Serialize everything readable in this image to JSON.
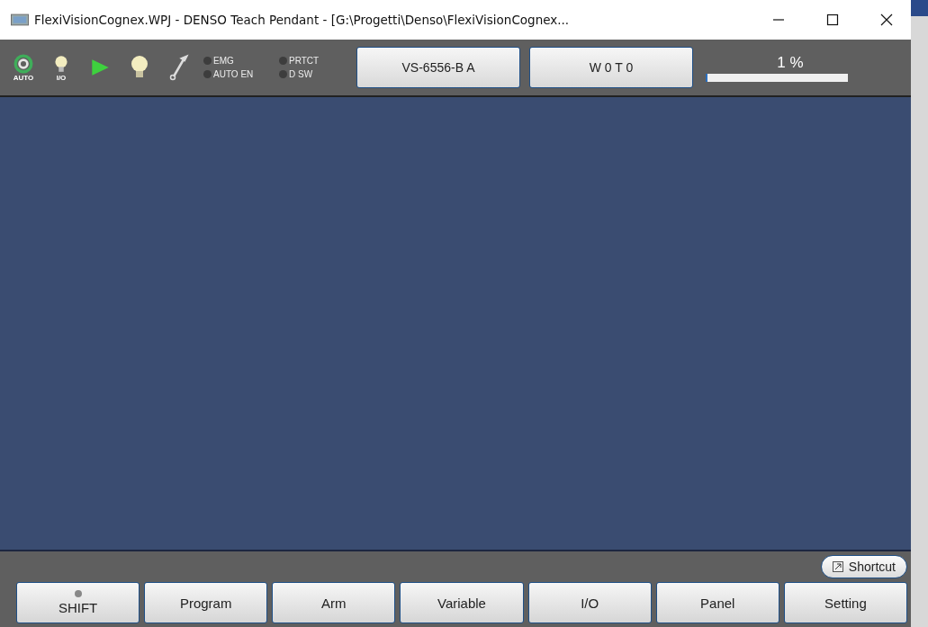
{
  "window": {
    "title": "FlexiVisionCognex.WPJ - DENSO Teach Pendant - [G:\\Progetti\\Denso\\FlexiVisionCognex..."
  },
  "toolbar": {
    "auto_label": "AUTO",
    "io_label": "I/O",
    "indicators": [
      {
        "label": "EMG",
        "on": false
      },
      {
        "label": "PRTCT",
        "on": false
      },
      {
        "label": "AUTO EN",
        "on": false
      },
      {
        "label": "D SW",
        "on": false
      }
    ],
    "robot_button": "VS-6556-B A",
    "work_tool_button": "W 0 T 0",
    "speed": {
      "reading": "1 %",
      "level": 0.01
    }
  },
  "shortcut_button": "Shortcut",
  "bottom_buttons": [
    {
      "label": "SHIFT",
      "kind": "led",
      "on": false
    },
    {
      "label": "Program",
      "kind": "plain"
    },
    {
      "label": "Arm",
      "kind": "plain"
    },
    {
      "label": "Variable",
      "kind": "plain"
    },
    {
      "label": "I/O",
      "kind": "plain"
    },
    {
      "label": "Panel",
      "kind": "plain"
    },
    {
      "label": "Setting",
      "kind": "plain"
    }
  ]
}
